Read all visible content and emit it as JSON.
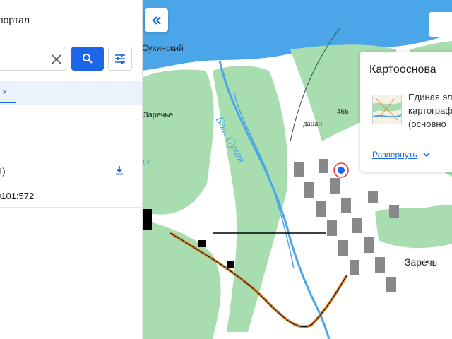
{
  "sidebar": {
    "portal_title": "портал",
    "search": {
      "value": "",
      "placeholder": ""
    },
    "tag_chip": "о ×",
    "result": {
      "title": "1)",
      "cadastral_number": "0101:572"
    }
  },
  "map": {
    "labels": {
      "suhinsky": "Сухинский",
      "zarechye_left": "Заречье",
      "river": "Бол. Сухая",
      "number_465": "465",
      "datsan": "дацан",
      "zarechye_right": "Заречь",
      "river_c": "ц е"
    }
  },
  "layer_panel": {
    "heading": "Картооснова",
    "line1": "Единая эл",
    "line2": "картограф",
    "line3": "(основно",
    "expand_label": "Развернуть"
  },
  "colors": {
    "accent": "#1b66e8",
    "water": "#4aa6e8",
    "forest": "#a8ddb0",
    "map_bg": "#ffffff"
  }
}
